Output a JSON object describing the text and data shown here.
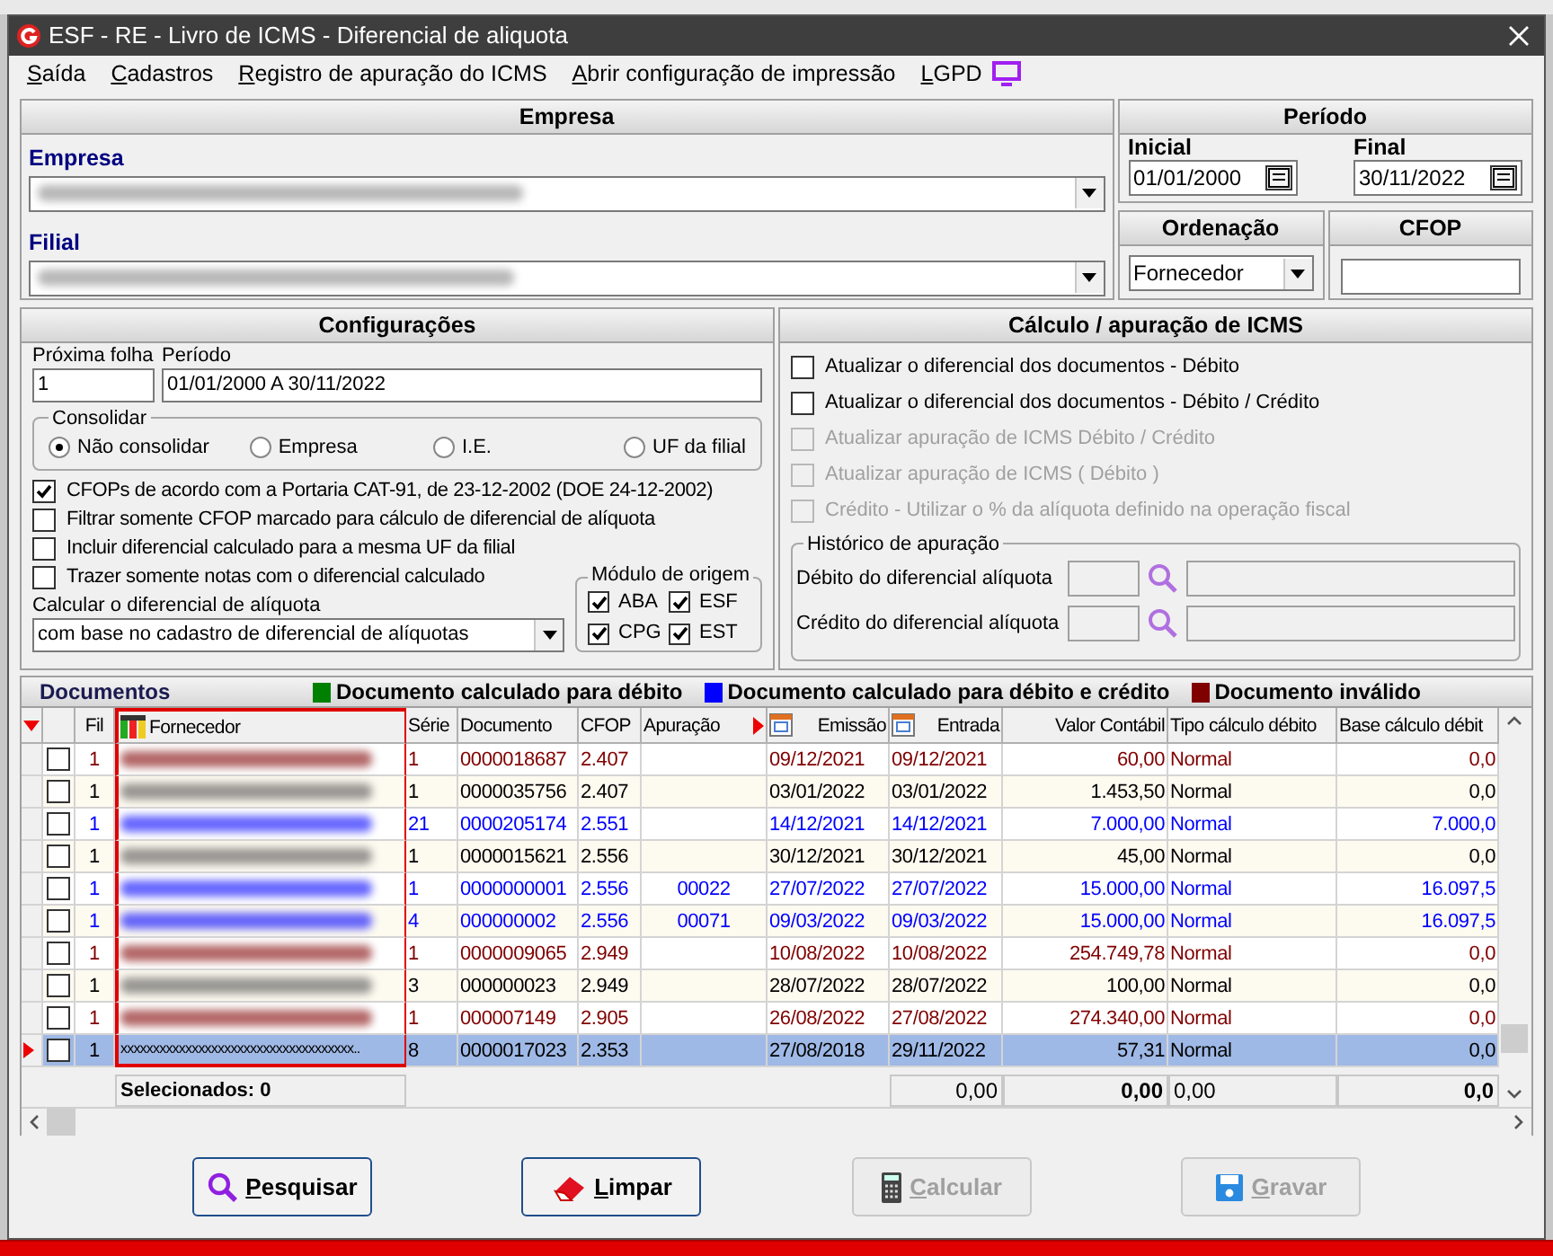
{
  "window": {
    "title": "ESF - RE - Livro de ICMS - Diferencial de aliquota"
  },
  "menu": [
    {
      "label": "Saída"
    },
    {
      "label": "Cadastros"
    },
    {
      "label": "Registro de apuração do ICMS"
    },
    {
      "label": "Abrir configuração de impressão"
    },
    {
      "label": "LGPD"
    }
  ],
  "empresa_group": {
    "title": "Empresa",
    "empresa_label": "Empresa",
    "filial_label": "Filial"
  },
  "periodo": {
    "title": "Período",
    "inicial_label": "Inicial",
    "inicial": "01/01/2000",
    "final_label": "Final",
    "final": "30/11/2022"
  },
  "ordenacao": {
    "title": "Ordenação",
    "value": "Fornecedor"
  },
  "cfop": {
    "title": "CFOP"
  },
  "configuracoes": {
    "title": "Configurações",
    "proxima_folha_label": "Próxima folha",
    "proxima_folha": "1",
    "periodo_label": "Período",
    "periodo": "01/01/2000 A 30/11/2022",
    "consolidar": {
      "title": "Consolidar",
      "options": [
        {
          "label": "Não consolidar",
          "selected": true
        },
        {
          "label": "Empresa",
          "selected": false
        },
        {
          "label": "I.E.",
          "selected": false
        },
        {
          "label": "UF da filial",
          "selected": false
        }
      ]
    },
    "checks": [
      {
        "label": "CFOPs de acordo com a Portaria CAT-91, de 23-12-2002 (DOE 24-12-2002)",
        "checked": true
      },
      {
        "label": "Filtrar somente CFOP marcado para cálculo de diferencial de alíquota",
        "checked": false
      },
      {
        "label": "Incluir diferencial calculado para a mesma UF da filial",
        "checked": false
      },
      {
        "label": "Trazer somente notas com o diferencial calculado",
        "checked": false
      }
    ],
    "calcular_label": "Calcular o diferencial de alíquota",
    "calcular_value": "com base no cadastro de diferencial de alíquotas",
    "modulo": {
      "title": "Módulo de origem",
      "options": [
        {
          "label": "ABA",
          "checked": true
        },
        {
          "label": "ESF",
          "checked": true
        },
        {
          "label": "CPG",
          "checked": true
        },
        {
          "label": "EST",
          "checked": true
        }
      ]
    }
  },
  "calculo": {
    "title": "Cálculo / apuração de ICMS",
    "checks": [
      {
        "label": "Atualizar o diferencial dos documentos - Débito",
        "checked": false,
        "disabled": false
      },
      {
        "label": "Atualizar o diferencial dos documentos - Débito / Crédito",
        "checked": false,
        "disabled": false
      },
      {
        "label": "Atualizar apuração de ICMS Débito / Crédito",
        "checked": false,
        "disabled": true
      },
      {
        "label": "Atualizar apuração de ICMS ( Débito )",
        "checked": false,
        "disabled": true
      },
      {
        "label": "Crédito - Utilizar o % da alíquota definido na operação fiscal",
        "checked": false,
        "disabled": true
      }
    ],
    "historico": {
      "title": "Histórico de apuração",
      "fields": [
        {
          "label": "Débito do diferencial alíquota"
        },
        {
          "label": "Crédito do diferencial alíquota"
        }
      ]
    }
  },
  "documentos": {
    "title": "Documentos",
    "legend": [
      {
        "label": "Documento calculado para débito",
        "color": "#008000"
      },
      {
        "label": "Documento calculado para débito e crédito",
        "color": "#0000ff"
      },
      {
        "label": "Documento inválido",
        "color": "#800000"
      }
    ],
    "columns": [
      "Fil",
      "Fornecedor",
      "Série",
      "Documento",
      "CFOP",
      "Apuração",
      "Emissão",
      "Entrada",
      "Valor Contábil",
      "Tipo cálculo débito",
      "Base cálculo débit"
    ],
    "rows": [
      {
        "color": "#800000",
        "checked": false,
        "selected": false,
        "fil": "1",
        "serie": "1",
        "documento": "0000018687",
        "cfop": "2.407",
        "apuracao": "",
        "emissao": "09/12/2021",
        "entrada": "09/12/2021",
        "valor": "60,00",
        "tipo": "Normal",
        "base": "0,0"
      },
      {
        "color": "#000000",
        "checked": false,
        "selected": false,
        "fil": "1",
        "serie": "1",
        "documento": "0000035756",
        "cfop": "2.407",
        "apuracao": "",
        "emissao": "03/01/2022",
        "entrada": "03/01/2022",
        "valor": "1.453,50",
        "tipo": "Normal",
        "base": "0,0"
      },
      {
        "color": "#0000ff",
        "checked": false,
        "selected": false,
        "fil": "1",
        "serie": "21",
        "documento": "0000205174",
        "cfop": "2.551",
        "apuracao": "",
        "emissao": "14/12/2021",
        "entrada": "14/12/2021",
        "valor": "7.000,00",
        "tipo": "Normal",
        "base": "7.000,0"
      },
      {
        "color": "#000000",
        "checked": false,
        "selected": false,
        "fil": "1",
        "serie": "1",
        "documento": "0000015621",
        "cfop": "2.556",
        "apuracao": "",
        "emissao": "30/12/2021",
        "entrada": "30/12/2021",
        "valor": "45,00",
        "tipo": "Normal",
        "base": "0,0"
      },
      {
        "color": "#0000ff",
        "checked": false,
        "selected": false,
        "fil": "1",
        "serie": "1",
        "documento": "0000000001",
        "cfop": "2.556",
        "apuracao": "00022",
        "emissao": "27/07/2022",
        "entrada": "27/07/2022",
        "valor": "15.000,00",
        "tipo": "Normal",
        "base": "16.097,5"
      },
      {
        "color": "#0000ff",
        "checked": false,
        "selected": false,
        "fil": "1",
        "serie": "4",
        "documento": "000000002",
        "cfop": "2.556",
        "apuracao": "00071",
        "emissao": "09/03/2022",
        "entrada": "09/03/2022",
        "valor": "15.000,00",
        "tipo": "Normal",
        "base": "16.097,5"
      },
      {
        "color": "#800000",
        "checked": false,
        "selected": false,
        "fil": "1",
        "serie": "1",
        "documento": "0000009065",
        "cfop": "2.949",
        "apuracao": "",
        "emissao": "10/08/2022",
        "entrada": "10/08/2022",
        "valor": "254.749,78",
        "tipo": "Normal",
        "base": "0,0"
      },
      {
        "color": "#000000",
        "checked": false,
        "selected": false,
        "fil": "1",
        "serie": "3",
        "documento": "000000023",
        "cfop": "2.949",
        "apuracao": "",
        "emissao": "28/07/2022",
        "entrada": "28/07/2022",
        "valor": "100,00",
        "tipo": "Normal",
        "base": "0,0"
      },
      {
        "color": "#800000",
        "checked": false,
        "selected": false,
        "fil": "1",
        "serie": "1",
        "documento": "000007149",
        "cfop": "2.905",
        "apuracao": "",
        "emissao": "26/08/2022",
        "entrada": "27/08/2022",
        "valor": "274.340,00",
        "tipo": "Normal",
        "base": "0,0"
      },
      {
        "color": "#000000",
        "checked": false,
        "selected": true,
        "fil": "1",
        "fornecedor": "xxxxxxxxxxxxxxxxxxxxxxxxxxxxxxxxxxxx..",
        "serie": "8",
        "documento": "0000017023",
        "cfop": "2.353",
        "apuracao": "",
        "emissao": "27/08/2018",
        "entrada": "29/11/2022",
        "valor": "57,31",
        "tipo": "Normal",
        "base": "0,0"
      }
    ],
    "footer": {
      "selecionados": "Selecionados: 0",
      "entrada_total": "0,00",
      "valor_total": "0,00",
      "tipo_total": "0,00",
      "base_total": "0,0"
    }
  },
  "buttons": [
    {
      "label": "Pesquisar",
      "kind": "search",
      "disabled": false
    },
    {
      "label": "Limpar",
      "kind": "eraser",
      "disabled": false
    },
    {
      "label": "Calcular",
      "kind": "calculator",
      "disabled": true
    },
    {
      "label": "Gravar",
      "kind": "save",
      "disabled": true
    }
  ]
}
